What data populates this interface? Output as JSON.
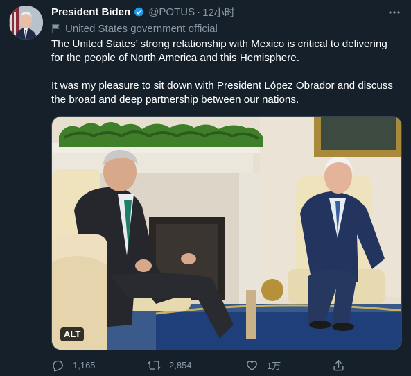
{
  "tweet": {
    "author_name": "President Biden",
    "handle": "@POTUS",
    "separator": "·",
    "time": "12小时",
    "account_label": "United States government official",
    "paragraphs": [
      "The United States’ strong relationship with Mexico is critical to delivering for the people of North America and this Hemisphere.",
      "It was my pleasure to sit down with President López Obrador and discuss the broad and deep partnership between our nations."
    ],
    "media_alt_badge": "ALT",
    "replies": "1,165",
    "retweets": "2,854",
    "likes": "1万"
  },
  "icons": {
    "verified": "verified-badge-icon",
    "more": "more-icon",
    "label": "government-flag-icon",
    "reply": "reply-icon",
    "retweet": "retweet-icon",
    "like": "heart-icon",
    "share": "share-icon"
  },
  "colors": {
    "background": "#15202b",
    "text_primary": "#ffffff",
    "text_secondary": "#8b98a5",
    "verified_blue": "#1d9bf0",
    "border": "#38444d"
  }
}
